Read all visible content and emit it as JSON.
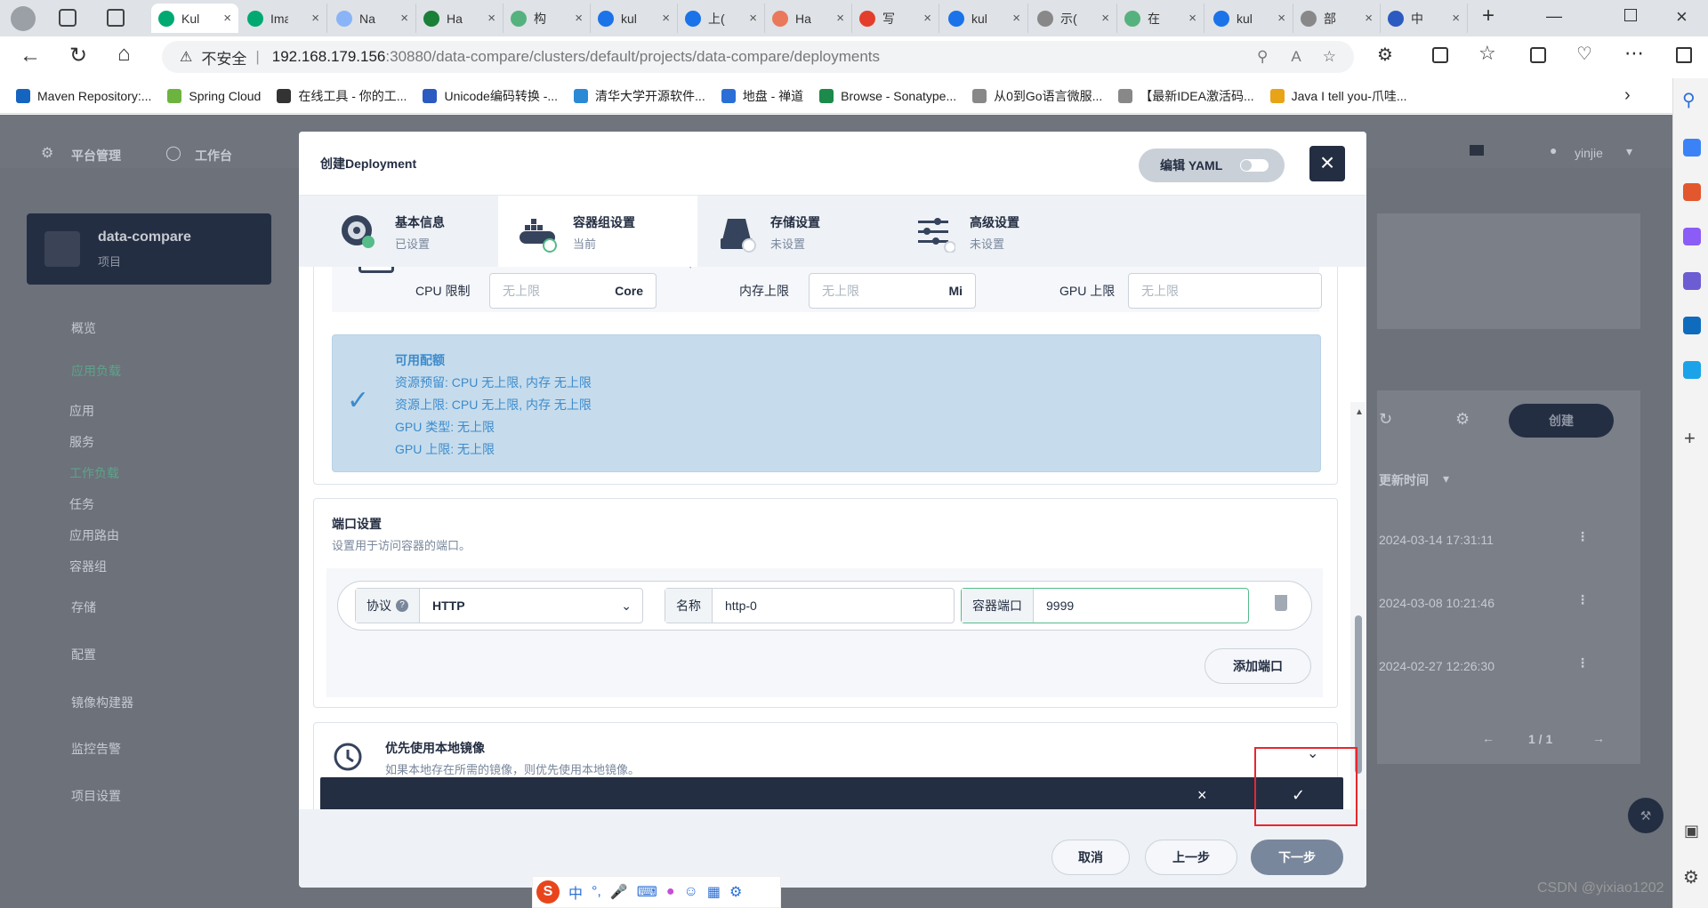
{
  "browser": {
    "tabs": [
      {
        "label": "Kul",
        "color": "#00a971",
        "active": true
      },
      {
        "label": "Ima",
        "color": "#00a971"
      },
      {
        "label": "Na",
        "color": "#8ab4f8"
      },
      {
        "label": "Ha",
        "color": "#1a7f37"
      },
      {
        "label": "构",
        "color": "#55b27e"
      },
      {
        "label": "kul",
        "color": "#1a73e8"
      },
      {
        "label": "上(",
        "color": "#1a73e8"
      },
      {
        "label": "Ha",
        "color": "#e9795a"
      },
      {
        "label": "写",
        "color": "#e33e2b"
      },
      {
        "label": "kul",
        "color": "#1a73e8"
      },
      {
        "label": "示(",
        "color": "#888"
      },
      {
        "label": "在",
        "color": "#55b27e"
      },
      {
        "label": "kul",
        "color": "#1a73e8"
      },
      {
        "label": "部",
        "color": "#888"
      },
      {
        "label": "中",
        "color": "#2b5ac0"
      }
    ],
    "insecure_label": "不安全",
    "url_host": "192.168.179.156",
    "url_path": ":30880/data-compare/clusters/default/projects/data-compare/deployments",
    "bookmarks": [
      {
        "label": "Maven Repository:...",
        "color": "#1565c0"
      },
      {
        "label": "Spring Cloud",
        "color": "#6db33f"
      },
      {
        "label": "在线工具 - 你的工...",
        "color": "#333"
      },
      {
        "label": "Unicode编码转换 -...",
        "color": "#2b5ac0"
      },
      {
        "label": "清华大学开源软件...",
        "color": "#2b8ad6"
      },
      {
        "label": "地盘 - 禅道",
        "color": "#2b6fd6"
      },
      {
        "label": "Browse - Sonatype...",
        "color": "#1b8a4a"
      },
      {
        "label": "从0到Go语言微服...",
        "color": "#888"
      },
      {
        "label": "【最新IDEA激活码...",
        "color": "#888"
      },
      {
        "label": "Java I tell you-爪哇...",
        "color": "#e8a317"
      }
    ]
  },
  "app": {
    "nav_platform": "平台管理",
    "nav_workbench": "工作台",
    "user": "yinjie",
    "project_name": "data-compare",
    "project_sub": "项目",
    "menu": {
      "overview": "概览",
      "workloads": "应用负载",
      "apps": "应用",
      "services": "服务",
      "workload": "工作负载",
      "jobs": "任务",
      "routes": "应用路由",
      "pods": "容器组",
      "storage": "存储",
      "config": "配置",
      "image_builder": "镜像构建器",
      "monitoring": "监控告警",
      "project_settings": "项目设置"
    },
    "create_button": "创建",
    "update_time_header": "更新时间",
    "rows": [
      "2024-03-14 17:31:11",
      "2024-03-08 10:21:46",
      "2024-02-27 12:26:30"
    ],
    "pagination": "1 / 1"
  },
  "modal": {
    "title": "创建Deployment",
    "edit_yaml": "编辑 YAML",
    "steps": [
      {
        "label": "基本信息",
        "status": "已设置"
      },
      {
        "label": "容器组设置",
        "status": "当前"
      },
      {
        "label": "存储设置",
        "status": "未设置"
      },
      {
        "label": "高级设置",
        "status": "未设置"
      }
    ],
    "limits": {
      "cpu_label": "CPU 限制",
      "cpu_placeholder": "无上限",
      "cpu_unit": "Core",
      "mem_label": "内存上限",
      "mem_placeholder": "无上限",
      "mem_unit": "Mi",
      "gpu_label": "GPU 上限",
      "gpu_placeholder": "无上限"
    },
    "quota": {
      "title": "可用配额",
      "lines": [
        "资源预留:  CPU 无上限, 内存 无上限",
        "资源上限:  CPU 无上限, 内存 无上限",
        "GPU 类型:  无上限",
        "GPU 上限:  无上限"
      ]
    },
    "ports": {
      "title": "端口设置",
      "desc": "设置用于访问容器的端口。",
      "protocol_label": "协议",
      "protocol_value": "HTTP",
      "name_label": "名称",
      "name_value": "http-0",
      "port_label": "容器端口",
      "port_value": "9999",
      "add_port": "添加端口"
    },
    "local_image": {
      "title": "优先使用本地镜像",
      "desc": "如果本地存在所需的镜像，则优先使用本地镜像。"
    },
    "footer": {
      "cancel": "取消",
      "prev": "上一步",
      "next": "下一步"
    }
  },
  "ime": {
    "label": "中"
  },
  "watermark": "CSDN @yixiao1202"
}
